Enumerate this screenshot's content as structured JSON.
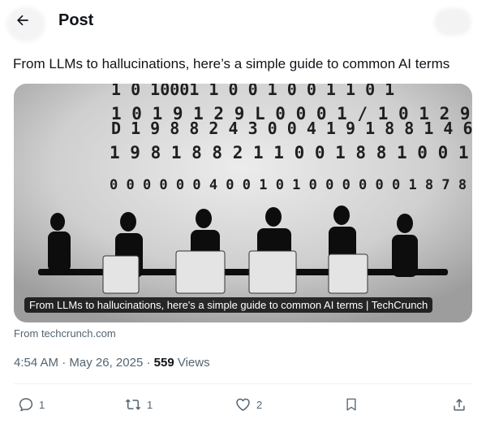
{
  "header": {
    "title": "Post",
    "back_icon": "arrow-left-icon"
  },
  "post": {
    "text": "From LLMs to hallucinations, here’s a simple guide to common AI terms"
  },
  "card": {
    "caption": "From LLMs to hallucinations, here's a simple guide to common AI terms | TechCrunch",
    "source": "From techcrunch.com",
    "image_subject": "silhouettes of people seated at a conference table in front of a wall of binary numbers"
  },
  "meta": {
    "time": "4:54 AM",
    "date": "May 26, 2025",
    "views_count": "559",
    "views_label": "Views"
  },
  "actions": {
    "reply_count": "1",
    "repost_count": "1",
    "like_count": "2",
    "icons": [
      "reply-icon",
      "repost-icon",
      "like-icon",
      "bookmark-icon",
      "share-icon"
    ]
  },
  "colors": {
    "text": "#0f1419",
    "secondary": "#536471",
    "caption_bg": "#000000"
  }
}
